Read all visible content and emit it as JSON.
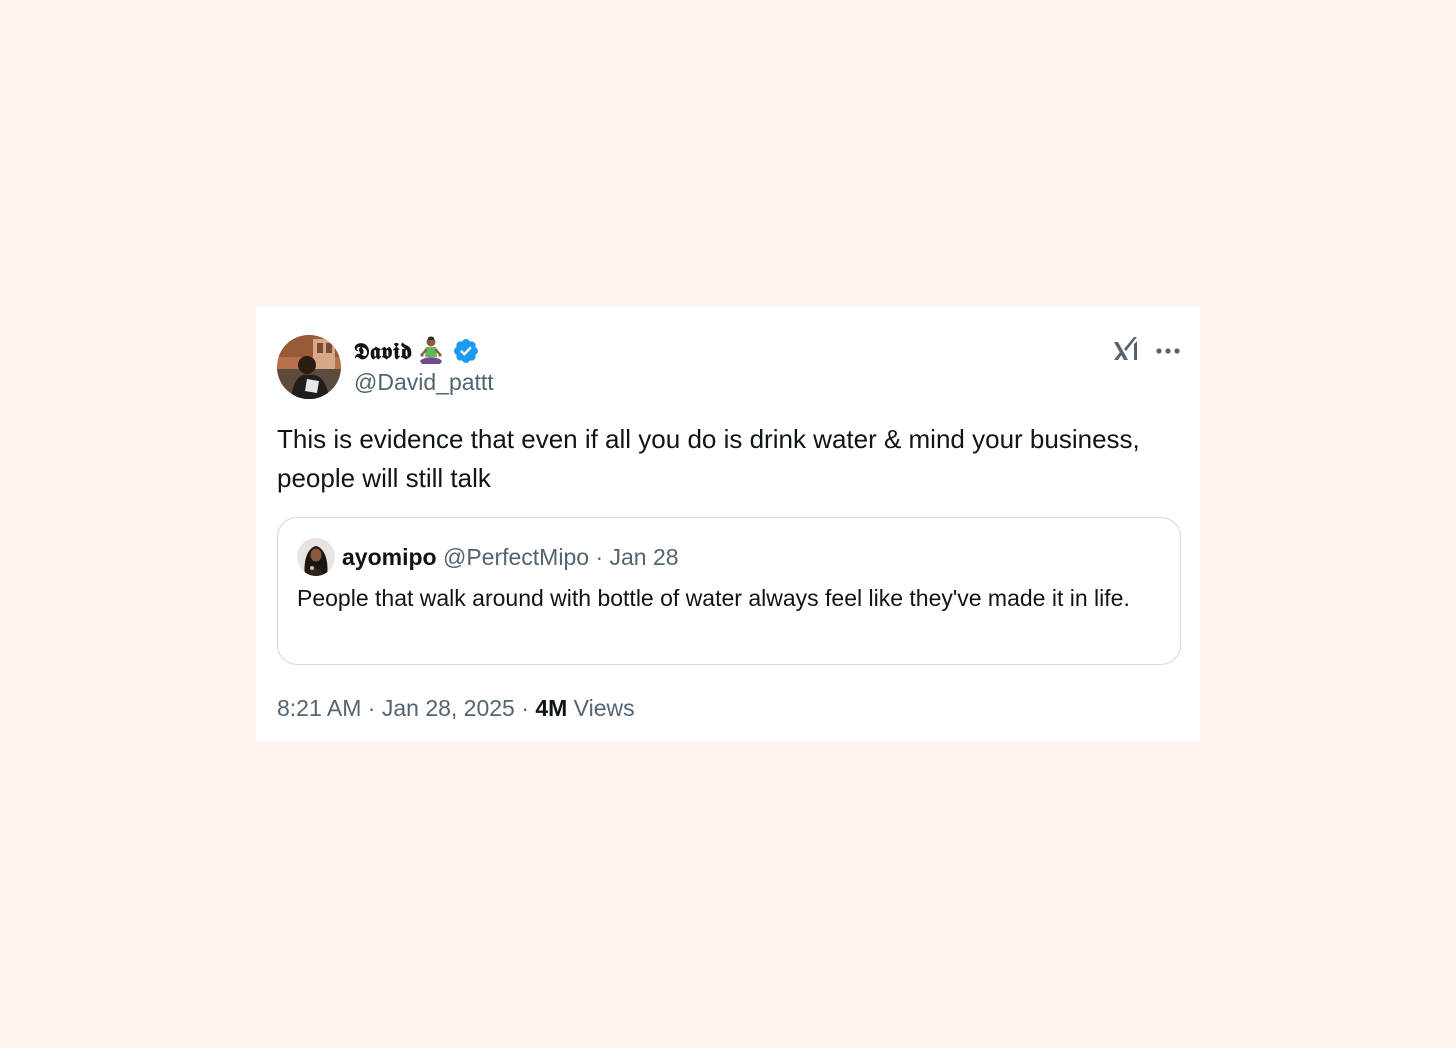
{
  "tweet": {
    "author": {
      "display_name": "𝕯𝖆𝖛𝖎𝖉",
      "emoji_icon": "person-in-lotus-position-icon",
      "verified_icon": "verified-badge-icon",
      "handle": "@David_pattt"
    },
    "header_icons": [
      "grok-x-logo-icon",
      "more-icon"
    ],
    "text": "This is evidence that even if all you do is drink water & mind your business, people will still talk",
    "quote": {
      "display_name": "ayomipo",
      "handle": "@PerfectMipo",
      "separator": "·",
      "date": "Jan 28",
      "text": "People that walk around with bottle of water always feel like they've made it in life."
    },
    "meta": {
      "time": "8:21 AM",
      "separator": "·",
      "date": "Jan 28, 2025",
      "separator2": "·",
      "views_count": "4M",
      "views_label": "Views"
    },
    "colors": {
      "background": "#fdf4ee",
      "card": "#ffffff",
      "text_primary": "#0f1419",
      "text_secondary": "#536471",
      "verified": "#1d9bf0",
      "quote_border": "#cfd9de"
    }
  }
}
